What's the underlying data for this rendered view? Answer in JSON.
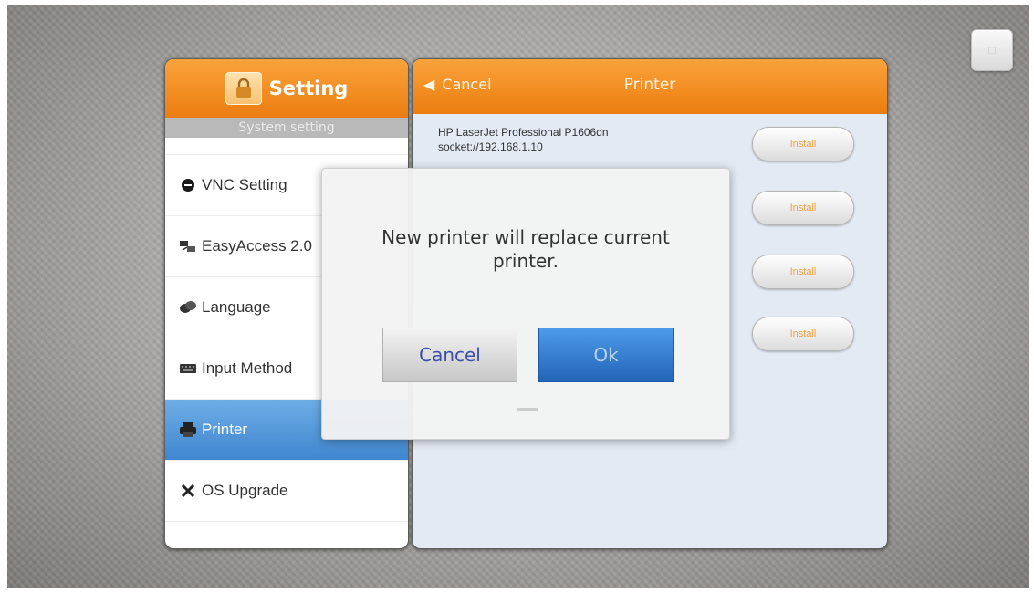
{
  "left_panel": {
    "title": "Setting",
    "subtitle": "System setting",
    "items": [
      {
        "label": "VNC Setting",
        "icon": "vnc-icon"
      },
      {
        "label": "EasyAccess 2.0",
        "icon": "easyaccess-icon"
      },
      {
        "label": "Language",
        "icon": "language-icon"
      },
      {
        "label": "Input Method",
        "icon": "keyboard-icon"
      },
      {
        "label": "Printer",
        "icon": "printer-icon",
        "active": true
      },
      {
        "label": "OS Upgrade",
        "icon": "tools-icon"
      }
    ]
  },
  "right_panel": {
    "back_label": "Cancel",
    "title": "Printer",
    "printers": [
      {
        "name": "HP LaserJet Professional P1606dn",
        "uri": "socket://192.168.1.10",
        "install_label": "Install"
      },
      {
        "name": "",
        "uri": "",
        "install_label": "Install"
      },
      {
        "name": "",
        "uri": "",
        "install_label": "Install"
      },
      {
        "name": "",
        "uri": "",
        "install_label": "Install"
      }
    ]
  },
  "dialog": {
    "message_line1": "New printer will replace current",
    "message_line2": "printer.",
    "cancel_label": "Cancel",
    "ok_label": "Ok"
  },
  "colors": {
    "header_orange": "#f39325",
    "active_blue": "#4a90d9",
    "ok_blue": "#2f78cc"
  }
}
